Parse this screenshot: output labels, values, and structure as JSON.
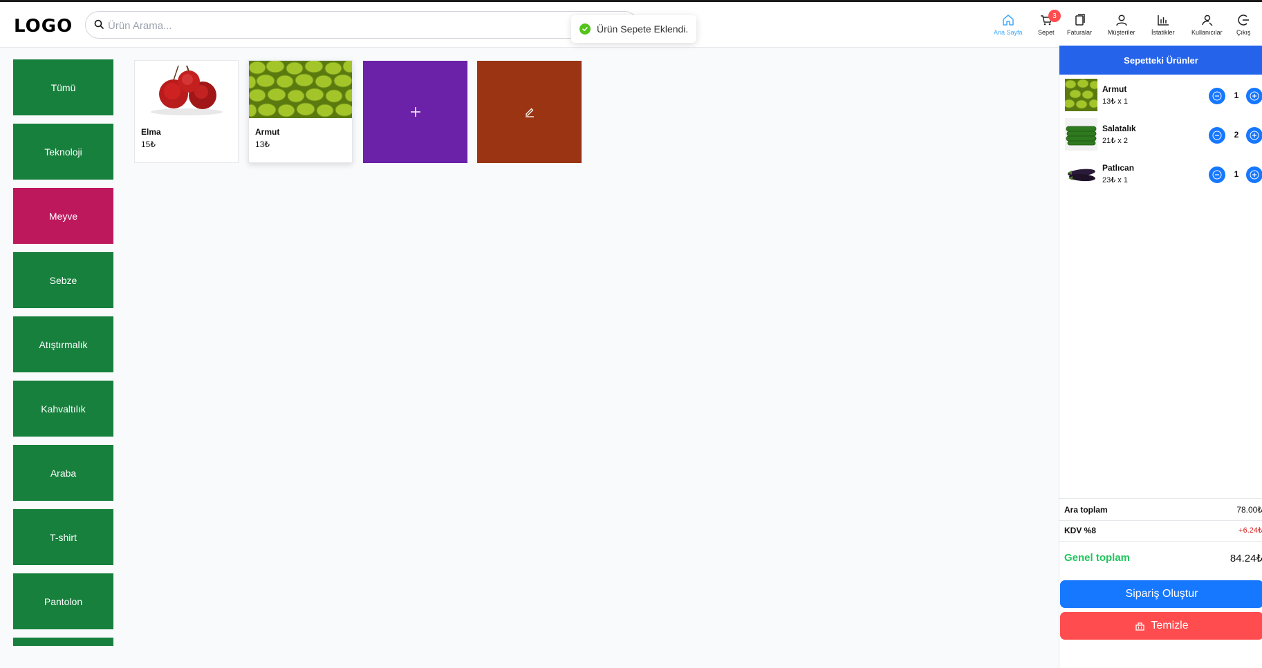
{
  "header": {
    "logo": "LOGO",
    "search_placeholder": "Ürün Arama...",
    "toast": "Ürün Sepete Eklendi.",
    "nav": [
      {
        "label": "Ana Sayfa",
        "icon": "home-icon",
        "active": true
      },
      {
        "label": "Sepet",
        "icon": "cart-icon",
        "badge": "3"
      },
      {
        "label": "Faturalar",
        "icon": "invoice-icon"
      },
      {
        "label": "Müşteriler",
        "icon": "user-icon"
      },
      {
        "label": "İstatikler",
        "icon": "stats-icon"
      },
      {
        "label": "Kullanıcılar",
        "icon": "users-icon"
      },
      {
        "label": "Çıkış",
        "icon": "logout-icon"
      }
    ]
  },
  "categories": [
    {
      "label": "Tümü"
    },
    {
      "label": "Teknoloji"
    },
    {
      "label": "Meyve",
      "active": true
    },
    {
      "label": "Sebze"
    },
    {
      "label": "Atıştırmalık"
    },
    {
      "label": "Kahvaltılık"
    },
    {
      "label": "Araba"
    },
    {
      "label": "T-shirt"
    },
    {
      "label": "Pantolon"
    }
  ],
  "products": [
    {
      "name": "Elma",
      "price": "15₺",
      "image": "apples"
    },
    {
      "name": "Armut",
      "price": "13₺",
      "image": "pears"
    }
  ],
  "tiles": {
    "add": {
      "icon": "plus-icon",
      "color": "#6b21a8"
    },
    "edit": {
      "icon": "edit-icon",
      "color": "#9a3412"
    }
  },
  "cart": {
    "title": "Sepetteki Ürünler",
    "items": [
      {
        "name": "Armut",
        "price": "13₺ x 1",
        "qty": "1",
        "image": "pears"
      },
      {
        "name": "Salatalık",
        "price": "21₺ x 2",
        "qty": "2",
        "image": "cucumbers"
      },
      {
        "name": "Patlıcan",
        "price": "23₺ x 1",
        "qty": "1",
        "image": "eggplant"
      }
    ],
    "subtotal_label": "Ara toplam",
    "subtotal_value": "78.00₺",
    "tax_label": "KDV %8",
    "tax_value": "+6.24₺",
    "total_label": "Genel toplam",
    "total_value": "84.24₺",
    "order_button": "Sipariş Oluştur",
    "clear_button": "Temizle"
  },
  "colors": {
    "category_green": "#17803d",
    "category_active": "#be185d",
    "primary_blue": "#1677ff",
    "danger_red": "#ff4d4f",
    "tax_red": "#dc2626",
    "total_green": "#22c55e"
  }
}
